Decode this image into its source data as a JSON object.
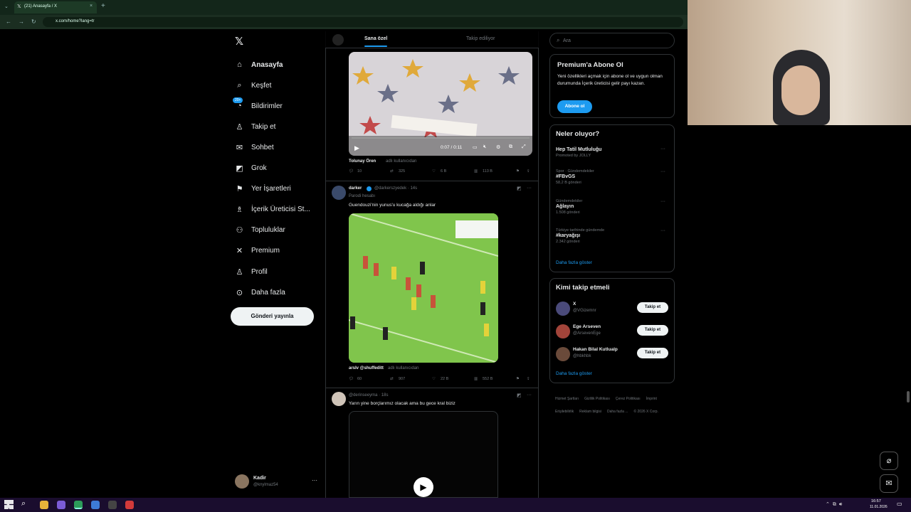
{
  "browser": {
    "tab_title": "(21) Anasayfa / X",
    "url": "x.com/home?lang=tr"
  },
  "nav": {
    "logo": "𝕏",
    "items": [
      {
        "label": "Anasayfa",
        "icon": "home-icon",
        "glyph": "⌂"
      },
      {
        "label": "Keşfet",
        "icon": "search-icon",
        "glyph": "⌕"
      },
      {
        "label": "Bildirimler",
        "icon": "bell-icon",
        "glyph": "◔"
      },
      {
        "label": "Takip et",
        "icon": "add-user-icon",
        "glyph": "♙"
      },
      {
        "label": "Sohbet",
        "icon": "mail-icon",
        "glyph": "✉"
      },
      {
        "label": "Grok",
        "icon": "grok-icon",
        "glyph": "◩"
      },
      {
        "label": "Yer İşaretleri",
        "icon": "bookmark-icon",
        "glyph": "⚑"
      },
      {
        "label": "İçerik Üreticisi St...",
        "icon": "creator-icon",
        "glyph": "♗"
      },
      {
        "label": "Topluluklar",
        "icon": "communities-icon",
        "glyph": "⚇"
      },
      {
        "label": "Premium",
        "icon": "x-icon",
        "glyph": "✕"
      },
      {
        "label": "Profil",
        "icon": "profile-icon",
        "glyph": "♙"
      },
      {
        "label": "Daha fazla",
        "icon": "more-icon",
        "glyph": "⊙"
      }
    ],
    "badge": "20+",
    "post_button": "Gönderi yayınla"
  },
  "profile": {
    "name": "Kadir",
    "handle": "@knylmaz54",
    "more": "···"
  },
  "feed": {
    "tabs": [
      "Sana özel",
      "Takip ediliyor"
    ],
    "tweet1": {
      "video_time": "0:07 / 0:11",
      "credit_name": "Tolunay Ören",
      "credit_note": "adlı kullanıcıdan",
      "replies": "10",
      "reposts": "325",
      "likes": "6 B",
      "views": "113 B"
    },
    "tweet2": {
      "name": "darker",
      "handle": "@darkerszyedek · 14s",
      "parody": "Parodi hesabı",
      "text": "Guendouzi'nin yunus'u kucağa aldığı anlar",
      "credit": "arslv @shuffeditt",
      "credit_note": "adlı kullanıcıdan",
      "replies": "60",
      "reposts": "907",
      "likes": "22 B",
      "views": "552 B"
    },
    "tweet3": {
      "handle": "@derinseeyma · 18s",
      "text": "Yarın yine borçlarımız olacak ama bu gece kral biziz"
    }
  },
  "right": {
    "search_placeholder": "Ara",
    "premium": {
      "title": "Premium'a Abone Ol",
      "text": "Yeni özellikleri açmak için abone ol ve uygun olman durumunda İçerik üreticisi gelir payı kazan.",
      "button": "Abone ol"
    },
    "trends": {
      "title": "Neler oluyor?",
      "items": [
        {
          "cat": "",
          "name": "Hep Tatil Mutluluğu",
          "meta": "Promoted by JOLLY"
        },
        {
          "cat": "Spor · Gündemdekiler",
          "name": "#FBvGS",
          "meta": "58,2 B gönderi"
        },
        {
          "cat": "Gündemdekiler",
          "name": "Ağlayın",
          "meta": "1.508 gönderi"
        },
        {
          "cat": "Türkiye tarihinde gündemde",
          "name": "#karyağışı",
          "meta": "2.342 gönderi"
        }
      ],
      "more": "Daha fazla göster"
    },
    "follow": {
      "title": "Kimi takip etmeli",
      "items": [
        {
          "name": "X",
          "handle": "@VGizemnr"
        },
        {
          "name": "Ege Arseven",
          "handle": "@ArsevenEge"
        },
        {
          "name": "Hakan Bilal Kutlualp",
          "handle": "@hbkhbk"
        }
      ],
      "button": "Takip et",
      "more": "Daha fazla göster"
    },
    "footer": [
      "Hizmet Şartları",
      "Gizlilik Politikası",
      "Çerez Politikası",
      "İmprint",
      "Erişilebilirlik",
      "Reklam bilgisi",
      "Daha fazla ...",
      "© 2026 X Corp."
    ]
  },
  "taskbar": {
    "time": "16:57",
    "date": "11.01.2026"
  }
}
